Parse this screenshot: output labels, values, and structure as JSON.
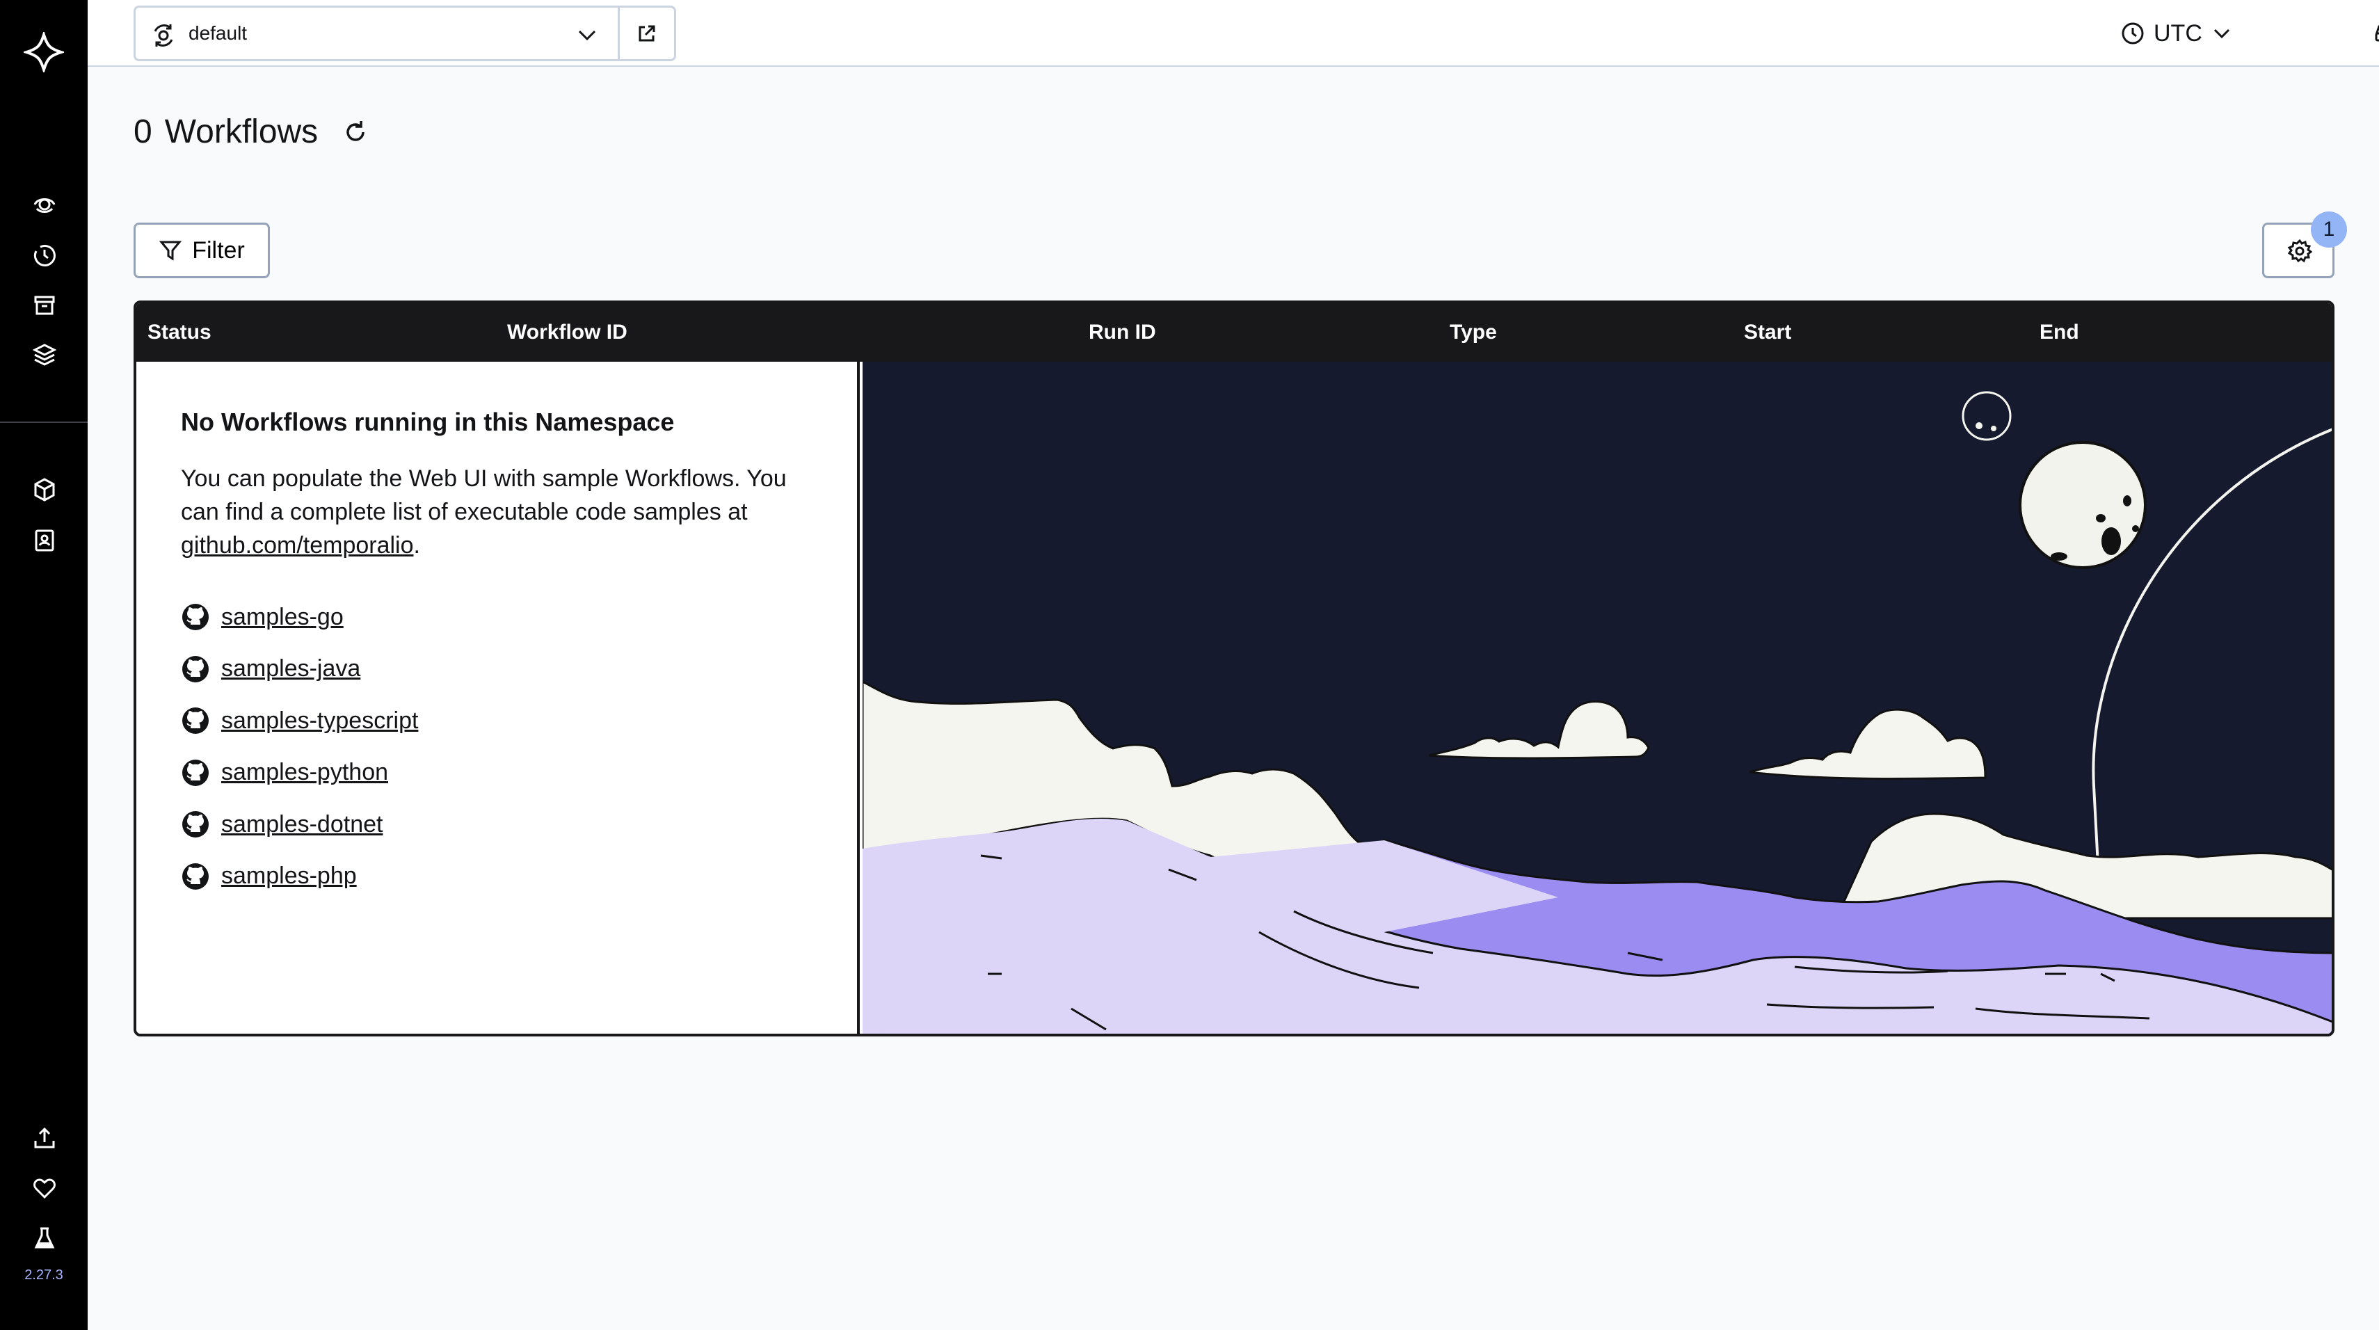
{
  "sidebar": {
    "logo_icon": "temporal-logo-icon",
    "nav_top": [
      "workflows-icon",
      "schedules-icon",
      "archive-icon",
      "namespaces-icon"
    ],
    "nav_middle": [
      "nexus-icon",
      "docs-icon"
    ],
    "nav_bottom": [
      "feedback-upload-icon",
      "heart-icon",
      "labs-icon"
    ],
    "version": "2.27.3"
  },
  "topbar": {
    "namespace": "default",
    "timezone": "UTC"
  },
  "page": {
    "count": "0",
    "title": "Workflows"
  },
  "toolbar": {
    "filter_label": "Filter",
    "settings_badge": "1"
  },
  "table": {
    "columns": [
      "Status",
      "Workflow ID",
      "Run ID",
      "Type",
      "Start",
      "End"
    ]
  },
  "empty": {
    "title": "No Workflows running in this Namespace",
    "text_before": "You can populate the Web UI with sample Workflows. You can find a complete list of executable code samples at ",
    "link": "github.com/temporalio",
    "text_after": ".",
    "samples": [
      "samples-go",
      "samples-java",
      "samples-typescript",
      "samples-python",
      "samples-dotnet",
      "samples-php"
    ]
  },
  "colors": {
    "sidebar_bg": "#000000",
    "header_bg": "#18181b",
    "sky": "#151a2e",
    "hill_light": "#dcd5f8",
    "hill_purple": "#9a8cf0",
    "badge": "#93b4f5"
  }
}
